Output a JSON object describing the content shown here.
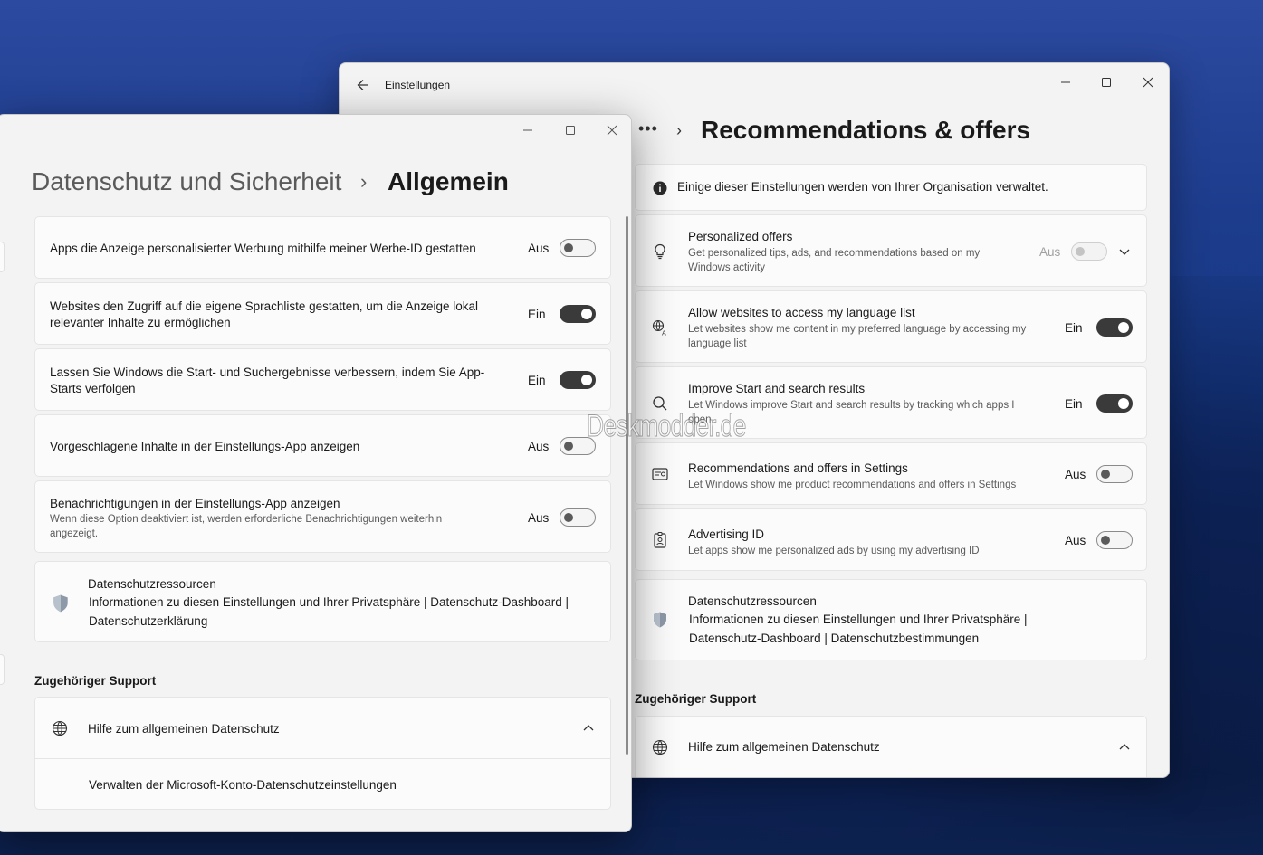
{
  "back_window": {
    "app_title": "Einstellungen",
    "breadcrumb_dots": "•••",
    "breadcrumb_sep": "›",
    "page_title": "Recommendations & offers",
    "info_banner": "Einige dieser Einstellungen werden von Ihrer Organisation verwaltet.",
    "rows": [
      {
        "title": "Personalized offers",
        "desc_line1": "Get personalized tips, ads, and recommendations based on my",
        "desc_line2": "Windows activity",
        "state": "Aus",
        "icon": "lightbulb-icon"
      },
      {
        "title": "Allow websites to access my language list",
        "desc_line1": "Let websites show me content in my preferred language by accessing my",
        "desc_line2": "language list",
        "state": "Ein",
        "icon": "language-icon"
      },
      {
        "title": "Improve Start and search results",
        "desc_line1": "Let Windows improve Start and search results by tracking which apps I",
        "desc_line2": "open",
        "state": "Ein",
        "icon": "search-icon"
      },
      {
        "title": "Recommendations and offers in Settings",
        "desc_line1": "Let Windows show me product recommendations and offers in Settings",
        "state": "Aus",
        "icon": "settings-card-icon"
      },
      {
        "title": "Advertising ID",
        "desc_line1": "Let apps show me personalized ads by using my advertising ID",
        "state": "Aus",
        "icon": "id-badge-icon"
      }
    ],
    "privacy_resources": {
      "title": "Datenschutzressourcen",
      "line1": "Informationen zu diesen Einstellungen und Ihrer Privatsphäre |",
      "line2": "Datenschutz-Dashboard | Datenschutzbestimmungen"
    },
    "support_heading": "Zugehöriger Support",
    "support_item": "Hilfe zum allgemeinen Datenschutz"
  },
  "front_window": {
    "breadcrumb_parent": "Datenschutz und Sicherheit",
    "breadcrumb_sep": "›",
    "page_title": "Allgemein",
    "rows": [
      {
        "line1": "Apps die Anzeige personalisierter Werbung mithilfe meiner Werbe-ID gestatten",
        "state": "Aus"
      },
      {
        "line1": "Websites den Zugriff auf die eigene Sprachliste gestatten, um die Anzeige lokal",
        "line2": "relevanter Inhalte zu ermöglichen",
        "state": "Ein"
      },
      {
        "line1": "Lassen Sie Windows die Start- und Suchergebnisse verbessern, indem Sie App-",
        "line2": "Starts verfolgen",
        "state": "Ein"
      },
      {
        "line1": "Vorgeschlagene Inhalte in der Einstellungs-App anzeigen",
        "state": "Aus"
      },
      {
        "line1": "Benachrichtigungen in der Einstellungs-App anzeigen",
        "desc_line1": "Wenn diese Option deaktiviert ist, werden erforderliche Benachrichtigungen weiterhin",
        "desc_line2": "angezeigt.",
        "state": "Aus"
      }
    ],
    "privacy_resources": {
      "title": "Datenschutzressourcen",
      "line1": "Informationen zu diesen Einstellungen und Ihrer Privatsphäre | Datenschutz-Dashboard |",
      "line2": "Datenschutzerklärung"
    },
    "support_heading": "Zugehöriger Support",
    "support_item": "Hilfe zum allgemeinen Datenschutz",
    "support_subitem": "Verwalten der Microsoft-Konto-Datenschutzeinstellungen"
  },
  "watermark": "Deskmodder.de"
}
